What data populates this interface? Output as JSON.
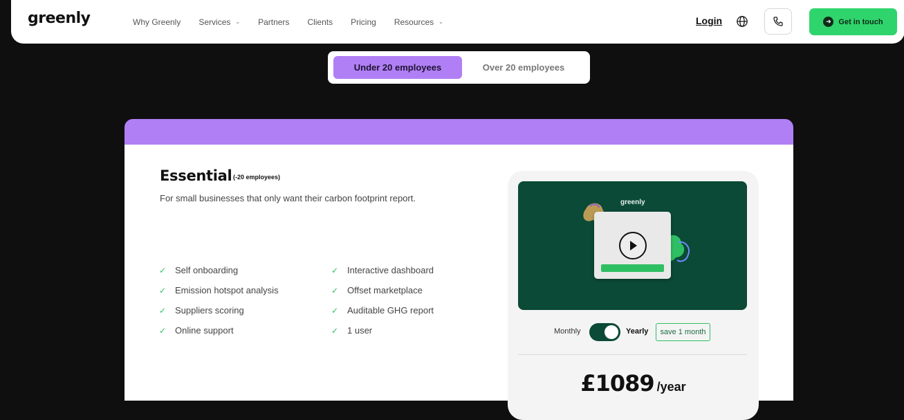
{
  "nav": {
    "logo": "greenly",
    "items": [
      {
        "label": "Why Greenly",
        "dropdown": false
      },
      {
        "label": "Services",
        "dropdown": true
      },
      {
        "label": "Partners",
        "dropdown": false
      },
      {
        "label": "Clients",
        "dropdown": false
      },
      {
        "label": "Pricing",
        "dropdown": false
      },
      {
        "label": "Resources",
        "dropdown": true
      }
    ],
    "login": "Login",
    "cta": "Get in touch",
    "icons": [
      "globe-icon",
      "phone-icon",
      "arrow-right-icon",
      "chevron-down-icon"
    ]
  },
  "segment": {
    "active": "Under 20 employees",
    "inactive": "Over 20 employees"
  },
  "plan": {
    "name": "Essential",
    "tag": "(-20 employees)",
    "description": "For small businesses that only want their carbon footprint report.",
    "features": [
      "Self onboarding",
      "Interactive dashboard",
      "Emission hotspot analysis",
      "Offset marketplace",
      "Suppliers scoring",
      "Auditable GHG report",
      "Online support",
      "1 user"
    ]
  },
  "video": {
    "logo": "greenly",
    "play_icon": "play-icon"
  },
  "billing": {
    "monthly": "Monthly",
    "yearly": "Yearly",
    "save": "save 1 month",
    "selected": "Yearly"
  },
  "price": {
    "amount": "£1089",
    "period": "/year"
  },
  "colors": {
    "accent_purple": "#b07ff5",
    "cta_green": "#2fd46c",
    "dark_green": "#0b4a36",
    "background": "#0f0f0f"
  }
}
